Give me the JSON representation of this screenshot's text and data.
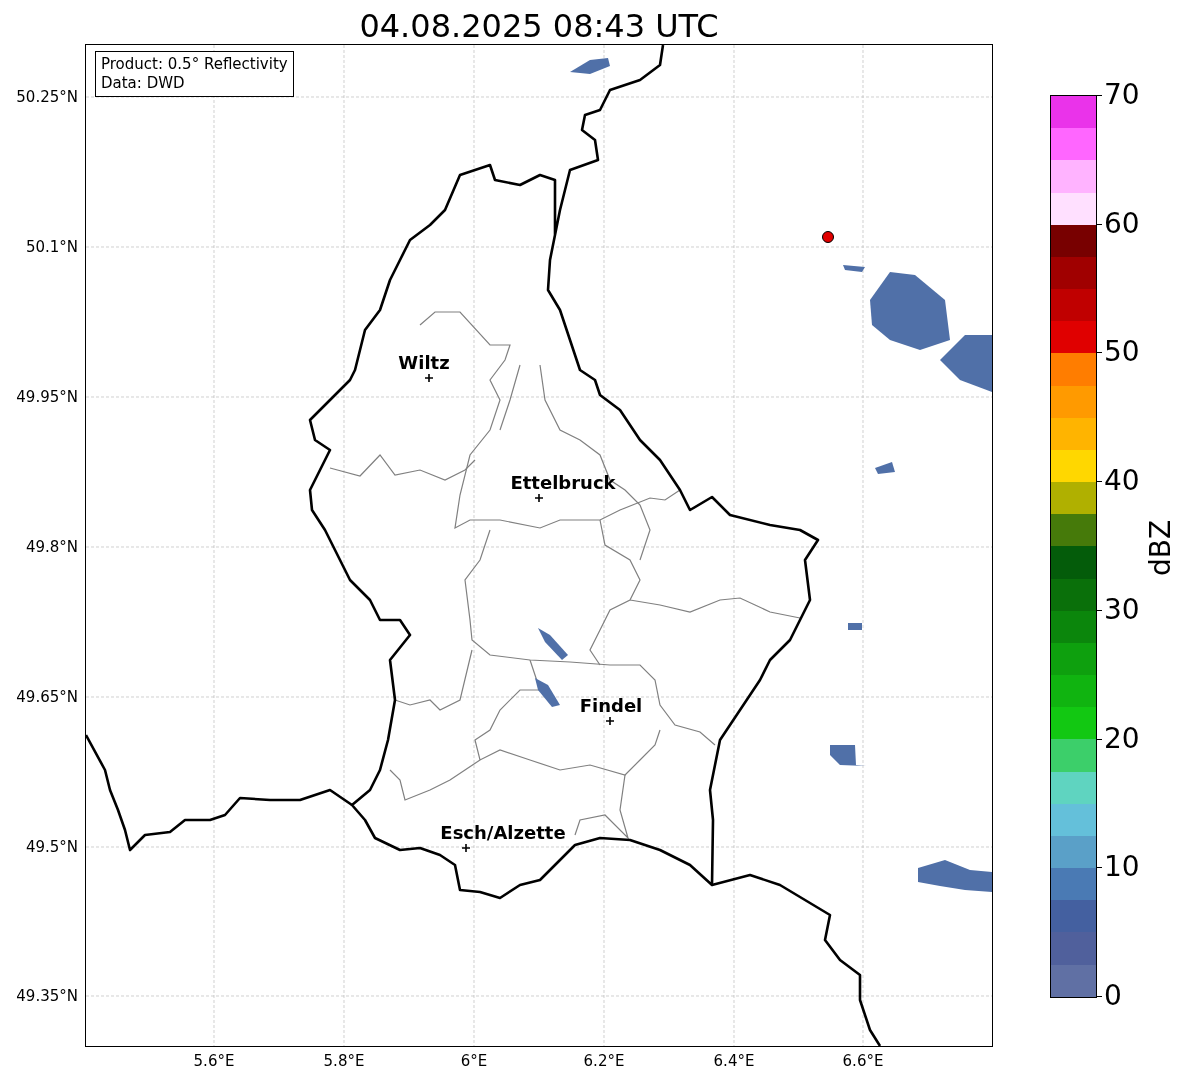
{
  "title": "04.08.2025 08:43 UTC",
  "info_box": [
    "Product: 0.5° Reflectivity",
    "Data: DWD"
  ],
  "y_ticks": [
    "50.25°N",
    "50.1°N",
    "49.95°N",
    "49.8°N",
    "49.65°N",
    "49.5°N",
    "49.35°N"
  ],
  "x_ticks": [
    "5.6°E",
    "5.8°E",
    "6°E",
    "6.2°E",
    "6.4°E",
    "6.6°E"
  ],
  "cities": [
    {
      "name": "Wiltz"
    },
    {
      "name": "Ettelbruck"
    },
    {
      "name": "Findel"
    },
    {
      "name": "Esch/Alzette"
    }
  ],
  "colorbar": {
    "ticks": [
      "70",
      "60",
      "50",
      "40",
      "30",
      "20",
      "10",
      "0"
    ],
    "label": "dBZ",
    "segments": [
      {
        "color": "#ea33ea"
      },
      {
        "color": "#ff66ff"
      },
      {
        "color": "#ffb3ff"
      },
      {
        "color": "#ffe0ff"
      },
      {
        "color": "#780000"
      },
      {
        "color": "#a00000"
      },
      {
        "color": "#c00000"
      },
      {
        "color": "#e00000"
      },
      {
        "color": "#ff7d00"
      },
      {
        "color": "#ff9a00"
      },
      {
        "color": "#ffb400"
      },
      {
        "color": "#ffd700"
      },
      {
        "color": "#b0b000"
      },
      {
        "color": "#467a0a"
      },
      {
        "color": "#045c0a"
      },
      {
        "color": "#0a700a"
      },
      {
        "color": "#0b860c"
      },
      {
        "color": "#0ea00e"
      },
      {
        "color": "#10b410"
      },
      {
        "color": "#12c812"
      },
      {
        "color": "#3ccf6a"
      },
      {
        "color": "#5fd4c0"
      },
      {
        "color": "#64c0da"
      },
      {
        "color": "#5aa0c8"
      },
      {
        "color": "#4a7ab4"
      },
      {
        "color": "#4460a0"
      },
      {
        "color": "#50609c"
      },
      {
        "color": "#6070a4"
      }
    ]
  }
}
